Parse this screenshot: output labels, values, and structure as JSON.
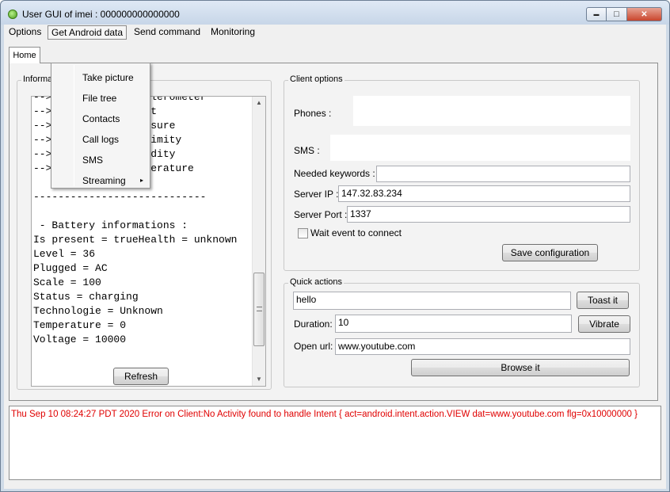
{
  "window": {
    "title": "User GUI of imei : 000000000000000"
  },
  "menubar": {
    "items": [
      "Options",
      "Get Android data",
      "Send command",
      "Monitoring"
    ]
  },
  "tabs": [
    "Home"
  ],
  "get_android_data_menu": {
    "items": [
      "Take picture",
      "File tree",
      "Contacts",
      "Call logs",
      "SMS",
      "Streaming"
    ],
    "submenu_arrow": "▸"
  },
  "information": {
    "title": "Informations",
    "lines": [
      "--> Genymotion Accelerometer",
      "--> Genymotion Light",
      "--> Genymotion Pressure",
      "--> Genymotion Proximity",
      "--> Genymotion Humidity",
      "--> Genymotion Temperature",
      "",
      "----------------------------",
      "",
      " - Battery informations :",
      "Is present = trueHealth = unknown",
      "Level = 36",
      "Plugged = AC",
      "Scale = 100",
      "Status = charging",
      "Technologie = Unknown",
      "Temperature = 0",
      "Voltage = 10000"
    ],
    "refresh_label": "Refresh"
  },
  "client_options": {
    "title": "Client options",
    "phones_label": "Phones :",
    "phones_value": "",
    "sms_label": "SMS :",
    "sms_value": "",
    "keywords_label": "Needed keywords :",
    "keywords_value": "",
    "server_ip_label": "Server IP :",
    "server_ip_value": "147.32.83.234",
    "server_port_label": "Server Port :",
    "server_port_value": "1337",
    "wait_event_label": "Wait event to connect",
    "wait_event_checked": false,
    "save_label": "Save configuration"
  },
  "quick_actions": {
    "title": "Quick actions",
    "toast_value": "hello",
    "toast_label": "Toast it",
    "duration_label": "Duration:",
    "duration_value": "10",
    "vibrate_label": "Vibrate",
    "open_url_label": "Open url:",
    "open_url_value": "www.youtube.com",
    "browse_label": "Browse it"
  },
  "log": {
    "lines": [
      "Thu Sep 10 08:24:27 PDT 2020 Error on Client:No Activity found to handle Intent { act=android.intent.action.VIEW dat=www.youtube.com flg=0x10000000 }"
    ],
    "color": "#e00000"
  },
  "window_controls": {
    "minimize": "▬",
    "maximize": "□",
    "close": "✕"
  }
}
